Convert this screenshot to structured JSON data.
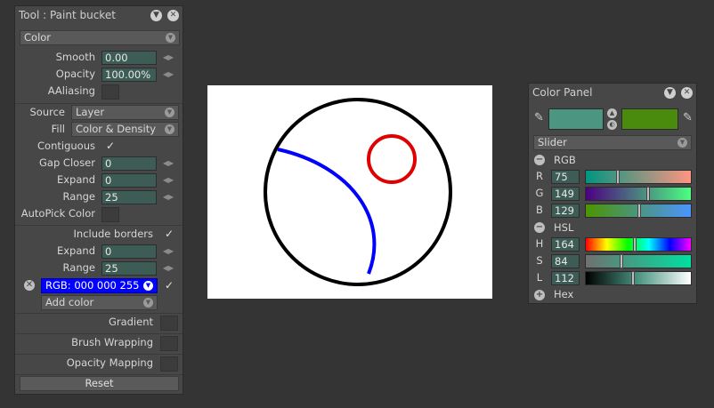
{
  "tool_panel": {
    "title": "Tool : Paint bucket",
    "mode_select": "Color",
    "smooth": {
      "label": "Smooth",
      "value": "0.00"
    },
    "opacity": {
      "label": "Opacity",
      "value": "100.00%"
    },
    "aaliasing": {
      "label": "AAliasing"
    },
    "source": {
      "label": "Source",
      "value": "Layer"
    },
    "fill": {
      "label": "Fill",
      "value": "Color & Density"
    },
    "contiguous": {
      "label": "Contiguous",
      "checked": true
    },
    "gap_closer": {
      "label": "Gap Closer",
      "value": "0"
    },
    "expand": {
      "label": "Expand",
      "value": "0"
    },
    "range": {
      "label": "Range",
      "value": "25"
    },
    "autopick": {
      "label": "AutoPick Color"
    },
    "include_borders": {
      "label": "Include borders",
      "checked": true
    },
    "border_expand": {
      "label": "Expand",
      "value": "0"
    },
    "border_range": {
      "label": "Range",
      "value": "25"
    },
    "border_color": {
      "label": "RGB: 000 000 255",
      "color": "#0000ff"
    },
    "add_color": "Add color",
    "gradient": "Gradient",
    "brush_wrapping": "Brush Wrapping",
    "opacity_mapping": "Opacity Mapping",
    "reset": "Reset"
  },
  "color_panel": {
    "title": "Color Panel",
    "primary_color": "#4b9581",
    "secondary_color": "#4a8a0c",
    "mode_select": "Slider",
    "rgb_section": "RGB",
    "r": {
      "label": "R",
      "value": "75",
      "level": 0.294
    },
    "g": {
      "label": "G",
      "value": "149",
      "level": 0.584
    },
    "b": {
      "label": "B",
      "value": "129",
      "level": 0.506
    },
    "hsl_section": "HSL",
    "h": {
      "label": "H",
      "value": "164",
      "level": 0.456
    },
    "s": {
      "label": "S",
      "value": "84",
      "level": 0.33
    },
    "l": {
      "label": "L",
      "value": "112",
      "level": 0.44
    },
    "hex_section": "Hex"
  },
  "colors": {
    "accent_blue": "#0000ff",
    "stroke_black": "#000000",
    "stroke_red": "#e00000"
  }
}
